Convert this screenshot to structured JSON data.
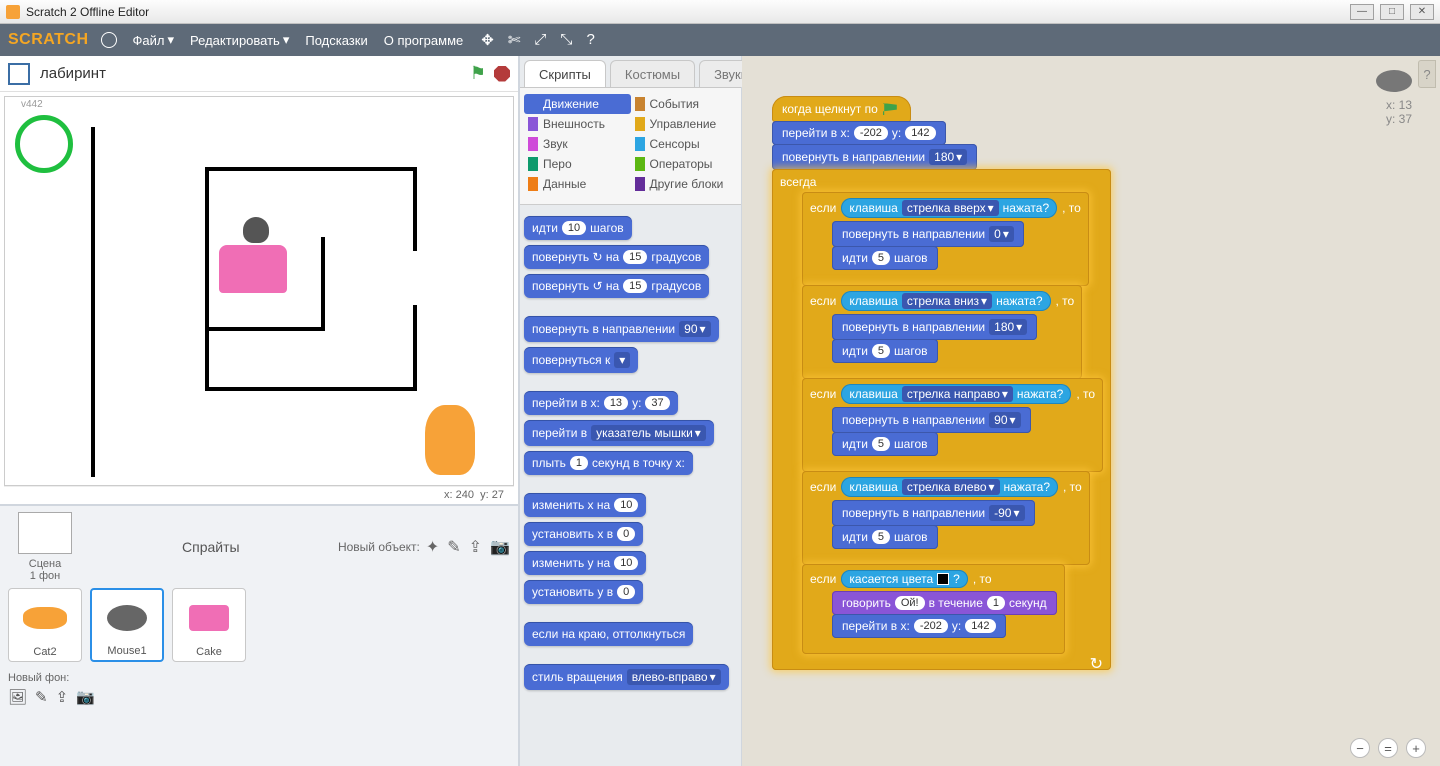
{
  "window": {
    "title": "Scratch 2 Offline Editor"
  },
  "menubar": {
    "logo": "SCRATCH",
    "file": "Файл",
    "edit": "Редактировать",
    "tips": "Подсказки",
    "about": "О программе"
  },
  "stage": {
    "title": "лабиринт",
    "corner": "v442",
    "footer_x": "x: 240",
    "footer_y": "y: 27"
  },
  "sprite_pane": {
    "label": "Спрайты",
    "new_label": "Новый объект:",
    "stage_label": "Сцена",
    "stage_sub": "1 фон",
    "new_bg": "Новый фон:",
    "sprites": [
      {
        "name": "Cat2"
      },
      {
        "name": "Mouse1",
        "selected": true
      },
      {
        "name": "Cake"
      }
    ]
  },
  "tabs": {
    "scripts": "Скрипты",
    "costumes": "Костюмы",
    "sounds": "Звуки"
  },
  "categories": {
    "motion": "Движение",
    "looks": "Внешность",
    "sound": "Звук",
    "pen": "Перо",
    "data": "Данные",
    "events": "События",
    "control": "Управление",
    "sensing": "Сенсоры",
    "operators": "Операторы",
    "more": "Другие блоки"
  },
  "palette": {
    "move_a": "идти",
    "move_v": "10",
    "move_b": "шагов",
    "turn_cw_a": "повернуть ↻ на",
    "turn_cw_v": "15",
    "turn_cw_b": "градусов",
    "turn_ccw_a": "повернуть ↺ на",
    "turn_ccw_v": "15",
    "turn_ccw_b": "градусов",
    "point_dir_a": "повернуть в направлении",
    "point_dir_v": "90",
    "point_to_a": "повернуться к",
    "point_to_v": "",
    "goto_xy_a": "перейти в x:",
    "goto_xy_x": "13",
    "goto_xy_b": "y:",
    "goto_xy_y": "37",
    "goto_obj_a": "перейти в",
    "goto_obj_v": "указатель мышки",
    "glide_a": "плыть",
    "glide_v": "1",
    "glide_b": "секунд в точку x:",
    "chx_a": "изменить x на",
    "chx_v": "10",
    "setx_a": "установить x в",
    "setx_v": "0",
    "chy_a": "изменить y на",
    "chy_v": "10",
    "sety_a": "установить y в",
    "sety_v": "0",
    "bounce": "если на краю, оттолкнуться",
    "rotmode_a": "стиль вращения",
    "rotmode_v": "влево-вправо"
  },
  "script": {
    "hat": "когда щелкнут по",
    "goto_a": "перейти в x:",
    "goto_x": "-202",
    "goto_b": "y:",
    "goto_y": "142",
    "point_a": "повернуть в направлении",
    "point_v": "180",
    "forever": "всегда",
    "if": "если",
    "then": ", то",
    "keypress_a": "клавиша",
    "keypress_b": "нажата?",
    "key_up": "стрелка вверх",
    "key_down": "стрелка вниз",
    "key_right": "стрелка направо",
    "key_left": "стрелка влево",
    "dir0": "0",
    "dir180": "180",
    "dir90": "90",
    "dirn90": "-90",
    "move_a": "идти",
    "move_v": "5",
    "move_b": "шагов",
    "touch_a": "касается цвета",
    "touch_b": "?",
    "say_a": "говорить",
    "say_msg": "Ой!",
    "say_b": "в течение",
    "say_sec": "1",
    "say_c": "секунд",
    "goto2_x": "-202",
    "goto2_y": "142"
  },
  "sprite_info": {
    "x_lbl": "x:",
    "x": "13",
    "y_lbl": "y:",
    "y": "37"
  }
}
